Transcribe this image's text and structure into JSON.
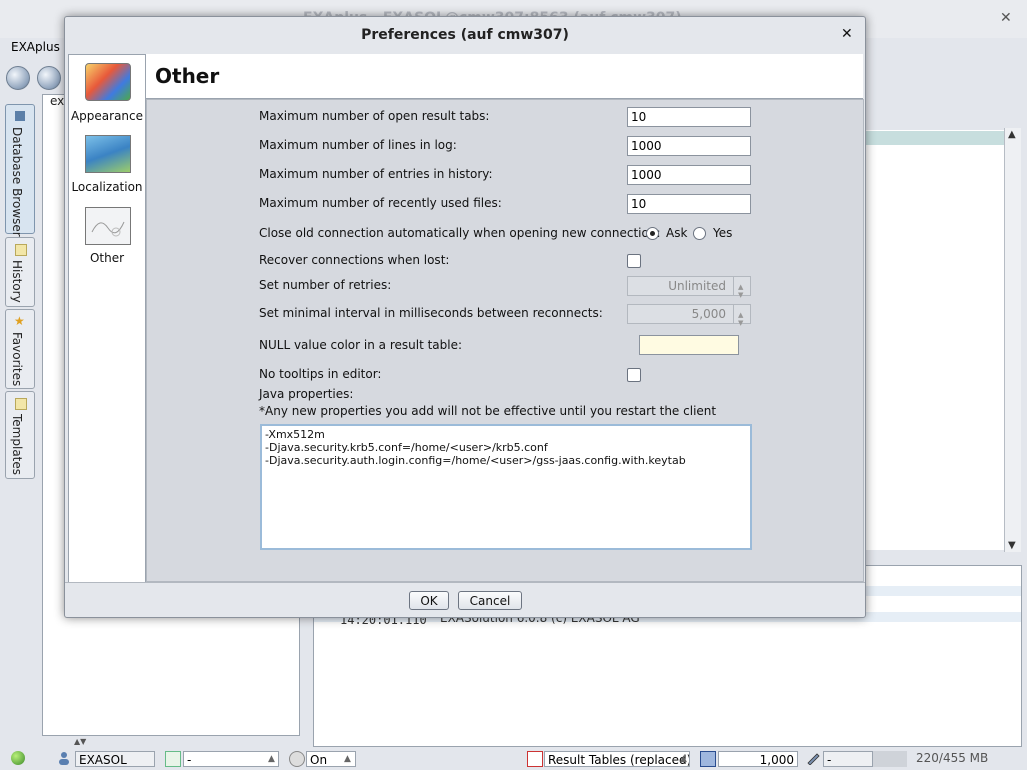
{
  "main_window": {
    "title": "EXAplus - EXASOL@cmw307:8563 (auf cmw307)",
    "menu": [
      "EXAplus"
    ],
    "side_tabs": [
      {
        "label": "Database Browser"
      },
      {
        "label": "History"
      },
      {
        "label": "Favorites"
      },
      {
        "label": "Templates"
      }
    ],
    "browser_tab_label": "exa",
    "log": {
      "time": "14:20:01.110",
      "message": "EXASolution 6.0.8 (c) EXASOL AG"
    }
  },
  "dialog": {
    "title": "Preferences (auf cmw307)",
    "categories": [
      {
        "label": "Appearance",
        "icon": "palette-icon"
      },
      {
        "label": "Localization",
        "icon": "world-map-icon"
      },
      {
        "label": "Other",
        "icon": "drawing-board-icon"
      }
    ],
    "page_title": "Other",
    "fields": {
      "max_result_tabs": {
        "label": "Maximum number of open result tabs:",
        "value": "10"
      },
      "max_log_lines": {
        "label": "Maximum number of lines in log:",
        "value": "1000"
      },
      "max_history": {
        "label": "Maximum number of entries in history:",
        "value": "1000"
      },
      "max_recent_files": {
        "label": "Maximum number of recently used files:",
        "value": "10"
      },
      "close_old_connection": {
        "label": "Close old connection automatically when opening new connection:",
        "options": [
          "Ask",
          "Yes"
        ],
        "selected": "Ask"
      },
      "recover_connections": {
        "label": "Recover connections when lost:",
        "checked": false
      },
      "retries": {
        "label": "Set number of retries:",
        "value": "Unlimited"
      },
      "min_interval": {
        "label": "Set minimal interval in milliseconds between reconnects:",
        "value": "5,000"
      },
      "null_color": {
        "label": "NULL value color in a result table:",
        "color": "#fffbe2"
      },
      "no_tooltips": {
        "label": "No tooltips in editor:",
        "checked": false
      },
      "java_properties": {
        "label": "Java properties:",
        "note": "*Any new properties you add will not be effective until you restart the client",
        "lines": [
          "-Xmx512m",
          "-Djava.security.krb5.conf=/home/<user>/krb5.conf",
          "-Djava.security.auth.login.config=/home/<user>/gss-jaas.config.with.keytab"
        ]
      }
    },
    "buttons": {
      "ok": "OK",
      "cancel": "Cancel"
    }
  },
  "statusbar": {
    "schema": "EXASOL",
    "schema_alt": "-",
    "autocommit": "On",
    "result_mode": "Result Tables (replaced)",
    "row_limit": "1,000",
    "extra": "-",
    "memory": "220/455 MB"
  }
}
